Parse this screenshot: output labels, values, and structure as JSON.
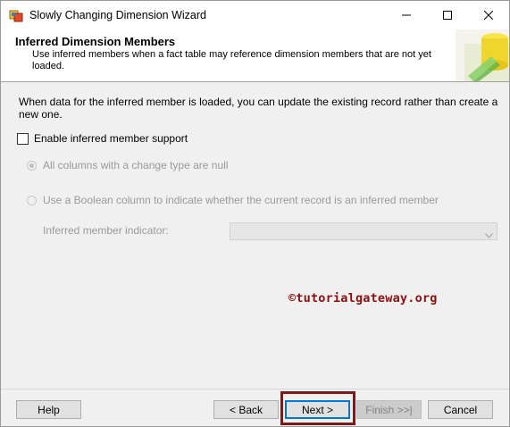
{
  "window": {
    "title": "Slowly Changing Dimension Wizard",
    "icon": "wizard-app-icon",
    "minimize_icon": "minimize-icon",
    "maximize_icon": "maximize-icon",
    "close_icon": "close-icon"
  },
  "header": {
    "title": "Inferred Dimension Members",
    "description": "Use inferred members when a fact table may reference dimension members that are not yet loaded."
  },
  "content": {
    "info": "When data for the inferred member is loaded, you can update the existing record rather than create a new one.",
    "enable_checkbox": {
      "label": "Enable inferred member support",
      "checked": false
    },
    "radio_null": {
      "label": "All columns with a change type are null",
      "selected": true,
      "enabled": false
    },
    "radio_boolean": {
      "label": "Use a Boolean column to indicate whether the current record is an inferred member",
      "selected": false,
      "enabled": false
    },
    "indicator": {
      "label": "Inferred member indicator:",
      "value": ""
    }
  },
  "watermark": "©tutorialgateway.org",
  "buttons": {
    "help": "Help",
    "back": "< Back",
    "next": "Next >",
    "finish": "Finish >>|",
    "cancel": "Cancel"
  },
  "colors": {
    "accent_focus": "#0078d7",
    "highlight_box": "#7a1a1a",
    "watermark": "#8b1010"
  }
}
